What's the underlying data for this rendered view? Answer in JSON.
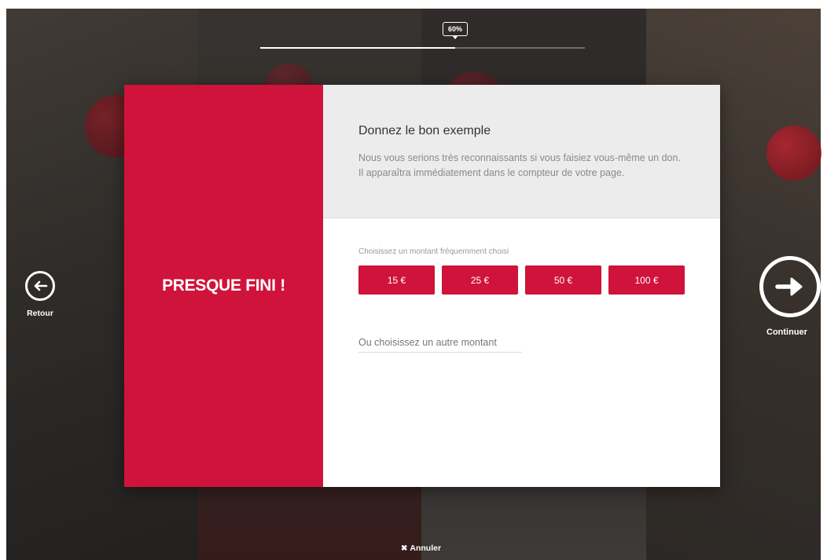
{
  "progress": {
    "value_percent": 60,
    "label": "60%"
  },
  "modal": {
    "heading": "PRESQUE FINI !",
    "title": "Donnez le bon exemple",
    "description": "Nous vous serions très reconnaissants si vous faisiez vous-même un don. Il apparaîtra immédiatement dans le compteur de votre page.",
    "amount_label": "Choisissez un montant fréquemment choisi",
    "amounts": [
      "15 €",
      "25 €",
      "50 €",
      "100 €"
    ],
    "custom_amount_placeholder": "Ou choisissez un autre montant"
  },
  "nav": {
    "back_label": "Retour",
    "next_label": "Continuer",
    "cancel_label": "Annuler"
  },
  "colors": {
    "accent": "#d0133a",
    "intro_bg": "#ececec"
  },
  "icons": {
    "back": "arrow-left-circle-icon",
    "next": "arrow-right-circle-icon",
    "cancel": "close-x-icon"
  }
}
